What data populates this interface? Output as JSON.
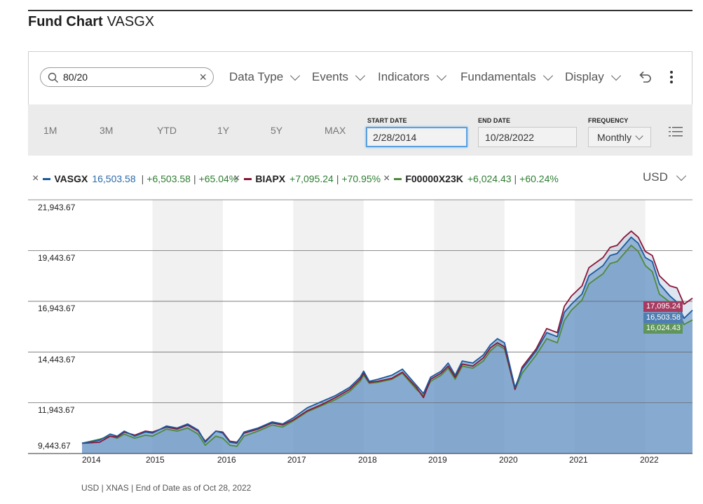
{
  "header": {
    "title": "Fund Chart",
    "symbol": "VASGX"
  },
  "search": {
    "value": "80/20"
  },
  "menus": {
    "data_type": "Data Type",
    "events": "Events",
    "indicators": "Indicators",
    "fundamentals": "Fundamentals",
    "display": "Display"
  },
  "ranges": [
    "1M",
    "3M",
    "YTD",
    "1Y",
    "5Y",
    "MAX"
  ],
  "dates": {
    "start_label": "START DATE",
    "start_value": "2/28/2014",
    "end_label": "END DATE",
    "end_value": "10/28/2022",
    "frequency_label": "FREQUENCY",
    "frequency_value": "Monthly"
  },
  "legend": [
    {
      "symbol": "VASGX",
      "value": "16,503.58",
      "change": "+6,503.58",
      "pct": "+65.04%",
      "color": "#1a5a9e"
    },
    {
      "symbol": "BIAPX",
      "value": "",
      "change": "+7,095.24",
      "pct": "+70.95%",
      "color": "#8a1538"
    },
    {
      "symbol": "F00000X23K",
      "value": "",
      "change": "+6,024.43",
      "pct": "+60.24%",
      "color": "#4e8a3a"
    }
  ],
  "currency": "USD",
  "footer": "USD | XNAS | End of Date as of Oct 28, 2022",
  "end_labels": [
    {
      "value": "17,095.24",
      "color": "#a63a60"
    },
    {
      "value": "16,503.58",
      "color": "#4f7fb2"
    },
    {
      "value": "16,024.43",
      "color": "#5f955a"
    }
  ],
  "chart_data": {
    "type": "area",
    "y_ticks": [
      "21,943.67",
      "19,443.67",
      "16,943.67",
      "14,443.67",
      "11,943.67",
      "9,443.67"
    ],
    "ylim": [
      9443.67,
      21943.67
    ],
    "x_ticks": [
      "2014",
      "2015",
      "2016",
      "2017",
      "2018",
      "2019",
      "2020",
      "2021",
      "2022"
    ],
    "xlim": [
      2014.0,
      2022.67
    ],
    "grid": true,
    "legend_position": "top",
    "series": [
      {
        "name": "VASGX",
        "color": "#1a5a9e",
        "points": [
          [
            2014.0,
            9950
          ],
          [
            2014.25,
            10100
          ],
          [
            2014.4,
            10400
          ],
          [
            2014.5,
            10300
          ],
          [
            2014.6,
            10550
          ],
          [
            2014.75,
            10300
          ],
          [
            2014.9,
            10500
          ],
          [
            2015.0,
            10450
          ],
          [
            2015.2,
            10800
          ],
          [
            2015.35,
            10700
          ],
          [
            2015.5,
            10900
          ],
          [
            2015.65,
            10600
          ],
          [
            2015.75,
            10000
          ],
          [
            2015.9,
            10550
          ],
          [
            2016.0,
            10450
          ],
          [
            2016.1,
            10000
          ],
          [
            2016.2,
            9950
          ],
          [
            2016.3,
            10500
          ],
          [
            2016.5,
            10700
          ],
          [
            2016.7,
            11000
          ],
          [
            2016.85,
            10900
          ],
          [
            2017.0,
            11200
          ],
          [
            2017.2,
            11700
          ],
          [
            2017.4,
            12000
          ],
          [
            2017.6,
            12300
          ],
          [
            2017.8,
            12700
          ],
          [
            2017.95,
            13200
          ],
          [
            2018.0,
            13500
          ],
          [
            2018.08,
            13000
          ],
          [
            2018.2,
            13100
          ],
          [
            2018.4,
            13300
          ],
          [
            2018.55,
            13600
          ],
          [
            2018.75,
            12800
          ],
          [
            2018.85,
            12400
          ],
          [
            2018.95,
            13200
          ],
          [
            2019.1,
            13500
          ],
          [
            2019.2,
            13900
          ],
          [
            2019.3,
            13300
          ],
          [
            2019.4,
            14000
          ],
          [
            2019.55,
            13900
          ],
          [
            2019.7,
            14300
          ],
          [
            2019.8,
            14800
          ],
          [
            2019.9,
            15100
          ],
          [
            2020.0,
            14900
          ],
          [
            2020.15,
            12700
          ],
          [
            2020.25,
            13600
          ],
          [
            2020.45,
            14500
          ],
          [
            2020.6,
            15400
          ],
          [
            2020.75,
            15200
          ],
          [
            2020.85,
            16400
          ],
          [
            2020.95,
            16800
          ],
          [
            2021.1,
            17300
          ],
          [
            2021.2,
            18200
          ],
          [
            2021.4,
            18700
          ],
          [
            2021.5,
            19200
          ],
          [
            2021.6,
            19300
          ],
          [
            2021.7,
            19700
          ],
          [
            2021.8,
            20100
          ],
          [
            2021.9,
            19800
          ],
          [
            2022.0,
            19100
          ],
          [
            2022.1,
            18900
          ],
          [
            2022.2,
            17800
          ],
          [
            2022.35,
            17200
          ],
          [
            2022.45,
            16900
          ],
          [
            2022.55,
            16100
          ],
          [
            2022.67,
            16503.58
          ]
        ]
      },
      {
        "name": "BIAPX",
        "color": "#8a1538",
        "points": [
          [
            2014.0,
            9950
          ],
          [
            2014.25,
            10000
          ],
          [
            2014.4,
            10300
          ],
          [
            2014.5,
            10250
          ],
          [
            2014.6,
            10500
          ],
          [
            2014.75,
            10350
          ],
          [
            2014.9,
            10550
          ],
          [
            2015.0,
            10500
          ],
          [
            2015.2,
            10750
          ],
          [
            2015.35,
            10650
          ],
          [
            2015.5,
            10850
          ],
          [
            2015.65,
            10550
          ],
          [
            2015.75,
            10050
          ],
          [
            2015.9,
            10550
          ],
          [
            2016.0,
            10500
          ],
          [
            2016.1,
            10050
          ],
          [
            2016.2,
            10000
          ],
          [
            2016.3,
            10450
          ],
          [
            2016.5,
            10650
          ],
          [
            2016.7,
            10950
          ],
          [
            2016.85,
            10850
          ],
          [
            2017.0,
            11100
          ],
          [
            2017.2,
            11550
          ],
          [
            2017.4,
            11850
          ],
          [
            2017.6,
            12200
          ],
          [
            2017.8,
            12600
          ],
          [
            2017.95,
            13100
          ],
          [
            2018.0,
            13400
          ],
          [
            2018.08,
            12950
          ],
          [
            2018.2,
            13000
          ],
          [
            2018.4,
            13150
          ],
          [
            2018.55,
            13450
          ],
          [
            2018.75,
            12700
          ],
          [
            2018.85,
            12200
          ],
          [
            2018.95,
            13100
          ],
          [
            2019.1,
            13400
          ],
          [
            2019.2,
            13750
          ],
          [
            2019.3,
            13200
          ],
          [
            2019.4,
            13850
          ],
          [
            2019.55,
            13750
          ],
          [
            2019.7,
            14150
          ],
          [
            2019.8,
            14650
          ],
          [
            2019.9,
            14900
          ],
          [
            2020.0,
            14700
          ],
          [
            2020.15,
            12600
          ],
          [
            2020.25,
            13700
          ],
          [
            2020.45,
            14600
          ],
          [
            2020.6,
            15600
          ],
          [
            2020.75,
            15400
          ],
          [
            2020.85,
            16700
          ],
          [
            2020.95,
            17200
          ],
          [
            2021.1,
            17700
          ],
          [
            2021.2,
            18600
          ],
          [
            2021.4,
            19100
          ],
          [
            2021.5,
            19600
          ],
          [
            2021.6,
            19700
          ],
          [
            2021.7,
            20100
          ],
          [
            2021.8,
            20400
          ],
          [
            2021.9,
            20100
          ],
          [
            2022.0,
            19400
          ],
          [
            2022.1,
            19200
          ],
          [
            2022.2,
            18200
          ],
          [
            2022.35,
            17700
          ],
          [
            2022.45,
            17600
          ],
          [
            2022.55,
            16800
          ],
          [
            2022.67,
            17095.24
          ]
        ]
      },
      {
        "name": "F00000X23K",
        "color": "#4e8a3a",
        "points": [
          [
            2014.0,
            9950
          ],
          [
            2014.25,
            10150
          ],
          [
            2014.4,
            10300
          ],
          [
            2014.5,
            10200
          ],
          [
            2014.6,
            10400
          ],
          [
            2014.75,
            10200
          ],
          [
            2014.9,
            10350
          ],
          [
            2015.0,
            10300
          ],
          [
            2015.2,
            10650
          ],
          [
            2015.35,
            10550
          ],
          [
            2015.5,
            10700
          ],
          [
            2015.65,
            10400
          ],
          [
            2015.75,
            9850
          ],
          [
            2015.9,
            10300
          ],
          [
            2016.0,
            10200
          ],
          [
            2016.1,
            9850
          ],
          [
            2016.2,
            9800
          ],
          [
            2016.3,
            10300
          ],
          [
            2016.5,
            10550
          ],
          [
            2016.7,
            10850
          ],
          [
            2016.85,
            10750
          ],
          [
            2017.0,
            11050
          ],
          [
            2017.2,
            11500
          ],
          [
            2017.4,
            11800
          ],
          [
            2017.6,
            12100
          ],
          [
            2017.8,
            12500
          ],
          [
            2017.95,
            13000
          ],
          [
            2018.0,
            13300
          ],
          [
            2018.08,
            12900
          ],
          [
            2018.2,
            12950
          ],
          [
            2018.4,
            13100
          ],
          [
            2018.55,
            13400
          ],
          [
            2018.75,
            12600
          ],
          [
            2018.85,
            12300
          ],
          [
            2018.95,
            13000
          ],
          [
            2019.1,
            13300
          ],
          [
            2019.2,
            13650
          ],
          [
            2019.3,
            13100
          ],
          [
            2019.4,
            13750
          ],
          [
            2019.55,
            13650
          ],
          [
            2019.7,
            14000
          ],
          [
            2019.8,
            14500
          ],
          [
            2019.9,
            14800
          ],
          [
            2020.0,
            14600
          ],
          [
            2020.15,
            12600
          ],
          [
            2020.25,
            13400
          ],
          [
            2020.45,
            14300
          ],
          [
            2020.6,
            15100
          ],
          [
            2020.75,
            14900
          ],
          [
            2020.85,
            16000
          ],
          [
            2020.95,
            16500
          ],
          [
            2021.1,
            17000
          ],
          [
            2021.2,
            17800
          ],
          [
            2021.4,
            18300
          ],
          [
            2021.5,
            18800
          ],
          [
            2021.6,
            18900
          ],
          [
            2021.7,
            19300
          ],
          [
            2021.8,
            19700
          ],
          [
            2021.9,
            19400
          ],
          [
            2022.0,
            18700
          ],
          [
            2022.1,
            18400
          ],
          [
            2022.2,
            17300
          ],
          [
            2022.35,
            16900
          ],
          [
            2022.45,
            16600
          ],
          [
            2022.55,
            15800
          ],
          [
            2022.67,
            16024.43
          ]
        ]
      }
    ]
  }
}
